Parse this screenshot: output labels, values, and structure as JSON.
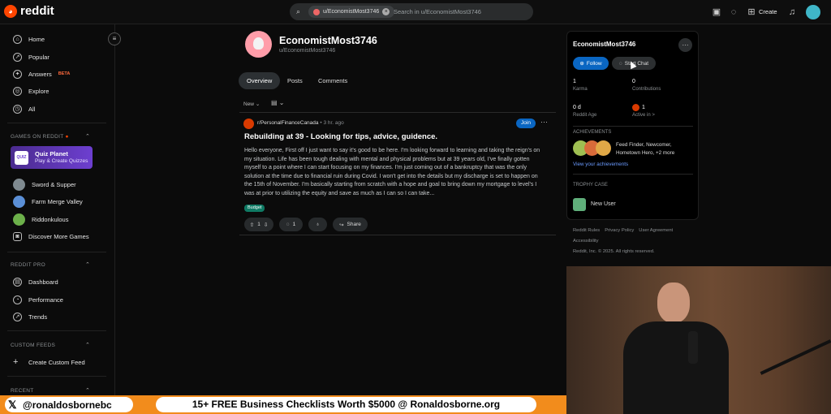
{
  "topbar": {
    "logo": "reddit",
    "search_chip": "u/EconomistMost3746",
    "search_placeholder": "Search in u/EconomistMost3746",
    "create_label": "Create"
  },
  "sidebar": {
    "nav": [
      {
        "label": "Home",
        "icon": "home-icon"
      },
      {
        "label": "Popular",
        "icon": "popular-icon"
      },
      {
        "label": "Answers",
        "badge": "BETA",
        "icon": "answers-icon"
      },
      {
        "label": "Explore",
        "icon": "explore-icon"
      },
      {
        "label": "All",
        "icon": "all-icon"
      }
    ],
    "games_header": "GAMES ON REDDIT",
    "quiz": {
      "title": "Quiz Planet",
      "subtitle": "Play & Create Quizzes",
      "logo": "QUIZ"
    },
    "games": [
      "Sword & Supper",
      "Farm Merge Valley",
      "Riddonkulous",
      "Discover More Games"
    ],
    "pro_header": "REDDIT PRO",
    "pro_items": [
      "Dashboard",
      "Performance",
      "Trends"
    ],
    "feeds_header": "CUSTOM FEEDS",
    "create_feed": "Create Custom Feed",
    "recent_header": "RECENT"
  },
  "profile": {
    "display_name": "EconomistMost3746",
    "username": "u/EconomistMost3746",
    "tabs": [
      "Overview",
      "Posts",
      "Comments"
    ],
    "sort_label": "New"
  },
  "post": {
    "subreddit": "r/PersonalFinanceCanada",
    "time": "3 hr. ago",
    "join_label": "Join",
    "title": "Rebuilding at 39 - Looking for tips, advice, guidence.",
    "body": "Hello everyone, First off I just want to say it's good to be here. I'm looking forward to learning and taking the reign's on my situation. Life has been tough dealing with mental and physical problems but at 39 years old, I've finally gotten myself to a point where I can start focusing on my finances. I'm just coming out of a bankruptcy that was the only solution at the time due to financial ruin during Covid. I won't get into the details but my discharge is set to happen on the 15th of November. I'm basically starting from scratch with a hope and goal to bring down my mortgage to level's I was at prior to utilizing the equity and save as much as I can so I can take...",
    "flair": "Budget",
    "votes": "1",
    "comments": "1",
    "share_label": "Share"
  },
  "card": {
    "name": "EconomistMost3746",
    "follow_label": "Follow",
    "chat_label": "Start Chat",
    "karma_value": "1",
    "karma_label": "Karma",
    "contrib_value": "0",
    "contrib_label": "Contributions",
    "age_value": "0 d",
    "age_label": "Reddit Age",
    "active_value": "1",
    "active_label": "Active in >",
    "achievements_header": "ACHIEVEMENTS",
    "achievements_text": "Feed Finder, Newcomer, Hometown Hero, +2 more",
    "view_achievements": "View your achievements",
    "trophy_header": "TROPHY CASE",
    "trophy": "New User"
  },
  "footer": {
    "links": [
      "Reddit Rules",
      "Privacy Policy",
      "User Agreement"
    ],
    "accessibility": "Accessibility",
    "copyright": "Reddit, Inc. © 2025. All rights reserved."
  },
  "banner": {
    "handle": "@ronaldosbornebc",
    "promo": "15+ FREE Business Checklists Worth $5000 @ Ronaldosborne.org"
  },
  "colors": {
    "brand": "#ff4500",
    "accent": "#0a66c2",
    "banner": "#f28c1c"
  }
}
